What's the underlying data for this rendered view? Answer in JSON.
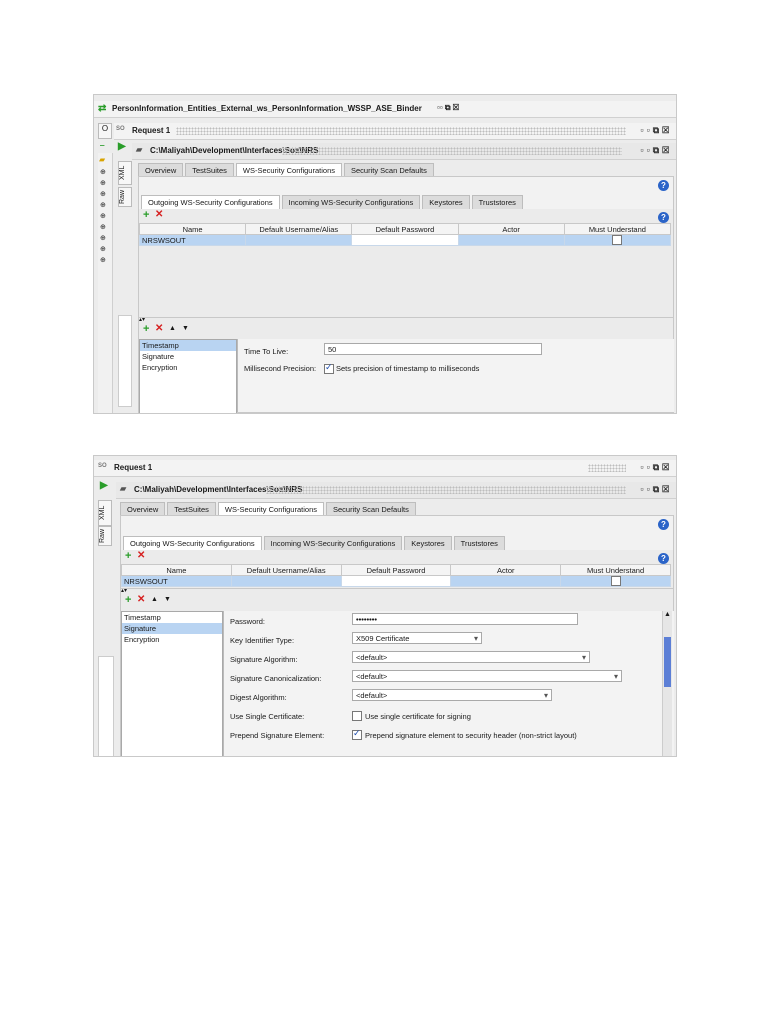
{
  "shot1": {
    "binder_title": "PersonInformation_Entities_External_ws_PersonInformation_WSSP_ASE_Binder",
    "request_title": "Request 1",
    "path": "C:\\Maliyah\\Development\\Interfaces\\Soa\\NRS",
    "main_tabs": [
      "Overview",
      "TestSuites",
      "WS-Security Configurations",
      "Security Scan Defaults"
    ],
    "sub_tabs": [
      "Outgoing WS-Security Configurations",
      "Incoming WS-Security Configurations",
      "Keystores",
      "Truststores"
    ],
    "columns": [
      "Name",
      "Default Username/Alias",
      "Default Password",
      "Actor",
      "Must Understand"
    ],
    "rows": [
      {
        "name": "NRSWSOUT",
        "username": "",
        "password": "",
        "actor": "",
        "must_understand": false
      }
    ],
    "entries": [
      "Timestamp",
      "Signature",
      "Encryption"
    ],
    "selected_entry": "Timestamp",
    "time_to_live_label": "Time To Live:",
    "time_to_live_value": "50",
    "millisecond_label": "Millisecond Precision:",
    "millisecond_checkbox_label": "Sets precision of timestamp to milliseconds",
    "side_tabs": [
      "XML",
      "Raw"
    ],
    "left_tab_letter": "O"
  },
  "shot2": {
    "request_title": "Request 1",
    "path": "C:\\Maliyah\\Development\\Interfaces\\Soa\\NRS",
    "main_tabs": [
      "Overview",
      "TestSuites",
      "WS-Security Configurations",
      "Security Scan Defaults"
    ],
    "sub_tabs": [
      "Outgoing WS-Security Configurations",
      "Incoming WS-Security Configurations",
      "Keystores",
      "Truststores"
    ],
    "columns": [
      "Name",
      "Default Username/Alias",
      "Default Password",
      "Actor",
      "Must Understand"
    ],
    "rows": [
      {
        "name": "NRSWSOUT",
        "username": "",
        "password": "",
        "actor": "",
        "must_understand": false
      }
    ],
    "entries": [
      "Timestamp",
      "Signature",
      "Encryption"
    ],
    "selected_entry": "Signature",
    "password_label": "Password:",
    "password_value": "••••••••",
    "key_identifier_label": "Key Identifier Type:",
    "key_identifier_value": "X509 Certificate",
    "signature_algorithm_label": "Signature Algorithm:",
    "signature_algorithm_value": "<default>",
    "signature_canon_label": "Signature Canonicalization:",
    "signature_canon_value": "<default>",
    "digest_label": "Digest Algorithm:",
    "digest_value": "<default>",
    "single_cert_label": "Use Single Certificate:",
    "single_cert_checkbox_label": "Use single certificate for signing",
    "prepend_label": "Prepend Signature Element:",
    "prepend_checkbox_label": "Prepend signature element to security header (non-strict layout)",
    "side_tabs": [
      "XML",
      "Raw"
    ]
  },
  "colors": {
    "selection": "#b9d4f2",
    "add": "#2a9d2a",
    "remove": "#d62020",
    "help": "#2b64c8"
  }
}
